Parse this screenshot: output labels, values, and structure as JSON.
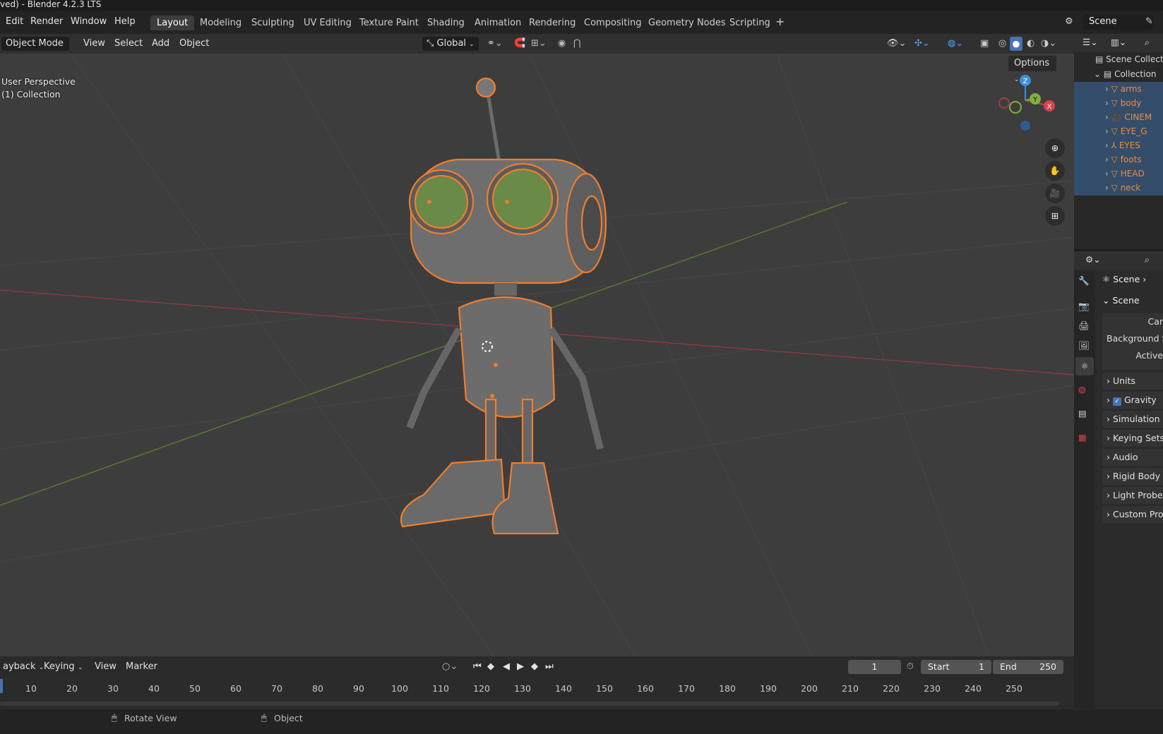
{
  "window_title": "ved) - Blender 4.2.3 LTS",
  "menus": [
    "Edit",
    "Render",
    "Window",
    "Help"
  ],
  "workspaces": [
    "Layout",
    "Modeling",
    "Sculpting",
    "UV Editing",
    "Texture Paint",
    "Shading",
    "Animation",
    "Rendering",
    "Compositing",
    "Geometry Nodes",
    "Scripting"
  ],
  "active_workspace": "Layout",
  "scene_selector": "Scene",
  "viewport_header": {
    "mode": "Object Mode",
    "menus": [
      "View",
      "Select",
      "Add",
      "Object"
    ],
    "transform_orientation": "Global",
    "options": "Options"
  },
  "viewport_info": {
    "perspective": "User Perspective",
    "collection": "(1) Collection"
  },
  "gizmo_axes": {
    "z": "Z",
    "y": "Y",
    "x": "X"
  },
  "outliner": {
    "root": "Scene Collecti",
    "collection": "Collection",
    "items": [
      {
        "name": "arms",
        "icon": "mesh-icon"
      },
      {
        "name": "body",
        "icon": "mesh-icon"
      },
      {
        "name": "CINEM",
        "icon": "camera-icon"
      },
      {
        "name": "EYE_G",
        "icon": "mesh-icon"
      },
      {
        "name": "EYES",
        "icon": "armature-icon"
      },
      {
        "name": "foots",
        "icon": "mesh-icon"
      },
      {
        "name": "HEAD",
        "icon": "mesh-icon"
      },
      {
        "name": "neck",
        "icon": "mesh-icon"
      }
    ]
  },
  "properties": {
    "context": "Scene",
    "panel_title": "Scene",
    "fields": [
      "Car",
      "Background S",
      "Active"
    ],
    "panels": [
      "Units",
      "Gravity",
      "Simulation",
      "Keying Sets",
      "Audio",
      "Rigid Body",
      "Light Probe",
      "Custom Pro"
    ],
    "gravity_checked": true
  },
  "timeline": {
    "menus": [
      "ayback",
      "Keying",
      "View",
      "Marker"
    ],
    "current_frame": "1",
    "start_label": "Start",
    "start": "1",
    "end_label": "End",
    "end": "250",
    "ticks": [
      "10",
      "20",
      "30",
      "40",
      "50",
      "60",
      "70",
      "80",
      "90",
      "100",
      "110",
      "120",
      "130",
      "140",
      "150",
      "160",
      "170",
      "180",
      "190",
      "200",
      "210",
      "220",
      "230",
      "240",
      "250"
    ]
  },
  "statusbar": {
    "left_hint": "Rotate View",
    "right_hint": "Object"
  },
  "colors": {
    "selection_outline": "#f07d2e",
    "outliner_selected": "#334d6b",
    "x_axis": "#d9434d",
    "y_axis": "#7fb13c",
    "z_axis": "#3a8fe0"
  }
}
